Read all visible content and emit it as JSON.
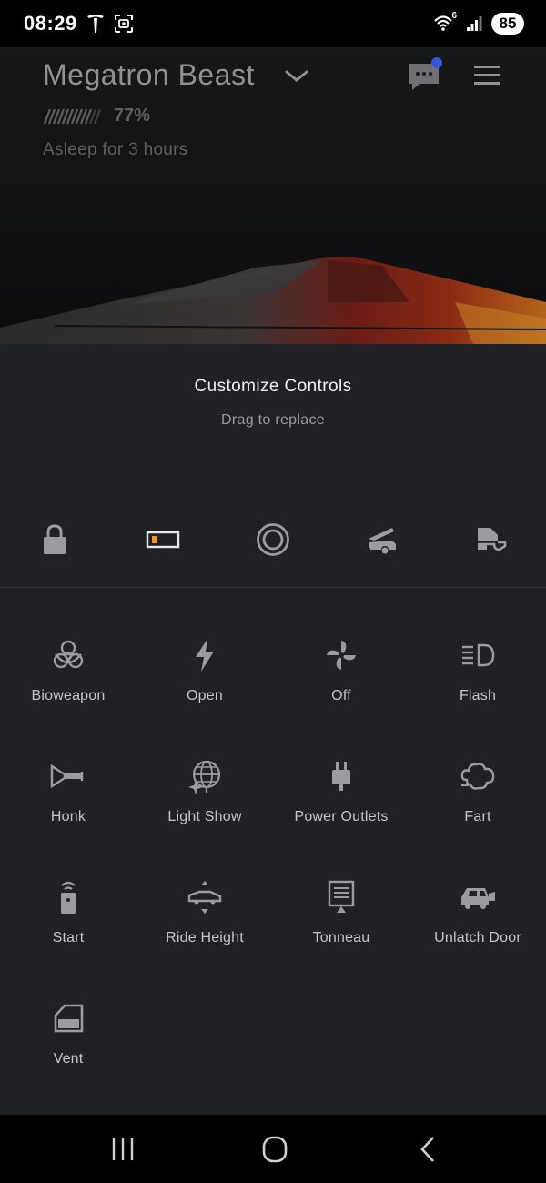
{
  "status_bar": {
    "time": "08:29",
    "network": "6",
    "battery": "85"
  },
  "vehicle": {
    "name": "Megatron Beast",
    "charge": "77%",
    "state": "Asleep for 3 hours"
  },
  "customize": {
    "title": "Customize Controls",
    "subtitle": "Drag to replace",
    "slots": [
      {
        "icon": "lock-icon"
      },
      {
        "icon": "charge-port-icon"
      },
      {
        "icon": "climate-ring-icon"
      },
      {
        "icon": "frunk-icon"
      },
      {
        "icon": "tailgate-icon"
      }
    ]
  },
  "controls": [
    {
      "label": "Bioweapon",
      "icon": "biohazard-icon"
    },
    {
      "label": "Open",
      "icon": "lightning-icon"
    },
    {
      "label": "Off",
      "icon": "fan-icon"
    },
    {
      "label": "Flash",
      "icon": "headlight-icon"
    },
    {
      "label": "Honk",
      "icon": "horn-icon"
    },
    {
      "label": "Light Show",
      "icon": "light-show-icon"
    },
    {
      "label": "Power Outlets",
      "icon": "power-plug-icon"
    },
    {
      "label": "Fart",
      "icon": "fart-cloud-icon"
    },
    {
      "label": "Start",
      "icon": "remote-start-icon"
    },
    {
      "label": "Ride Height",
      "icon": "ride-height-icon"
    },
    {
      "label": "Tonneau",
      "icon": "tonneau-icon"
    },
    {
      "label": "Unlatch Door",
      "icon": "unlatch-door-icon"
    },
    {
      "label": "Vent",
      "icon": "window-vent-icon"
    }
  ],
  "colors": {
    "accent_orange": "#f0962a",
    "notification_dot": "#3457d5",
    "panel_bg": "#202124"
  }
}
